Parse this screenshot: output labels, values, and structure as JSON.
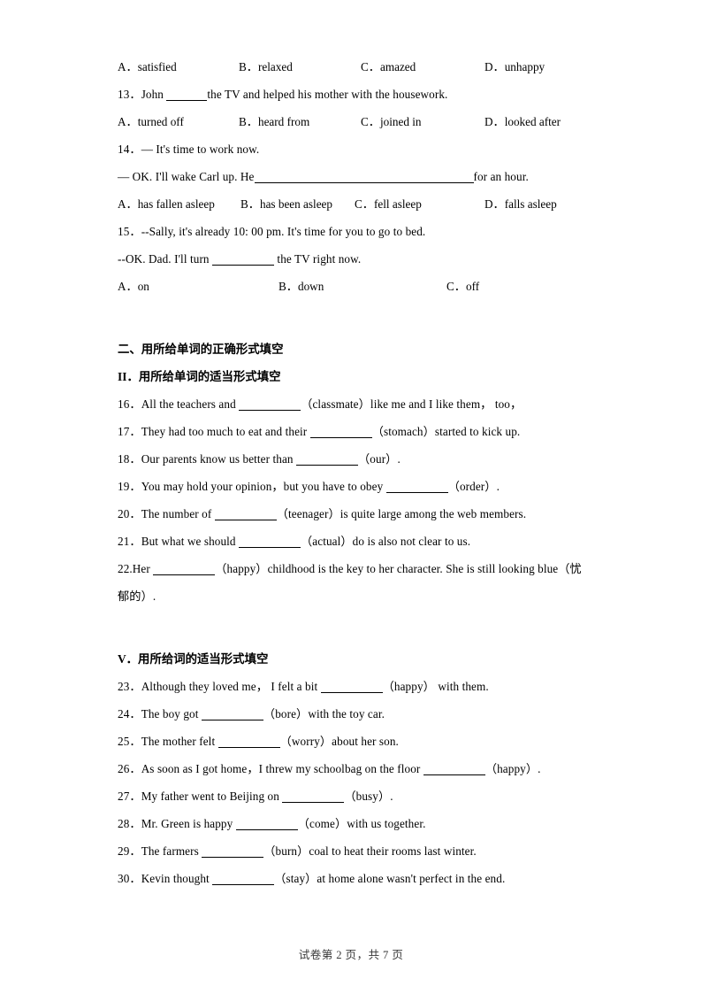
{
  "page": {
    "footer": "试卷第 2 页，共 7 页"
  },
  "multiple_choice": {
    "q12_options": [
      {
        "label": "A．satisfied"
      },
      {
        "label": "B．relaxed"
      },
      {
        "label": "C．amazed"
      },
      {
        "label": "D．unhappy"
      }
    ],
    "q13": {
      "number": "13．",
      "text_before": "John ",
      "text_after": "the TV and helped his mother with the housework.",
      "options": [
        {
          "label": "A．turned off"
        },
        {
          "label": "B．heard from"
        },
        {
          "label": "C．joined in"
        },
        {
          "label": "D．looked after"
        }
      ]
    },
    "q14": {
      "number": "14．",
      "line1": "— It's time to work now.",
      "line2_before": "— OK. I'll wake Carl up. He",
      "line2_after": "for an hour.",
      "options": [
        {
          "label": "A．has fallen asleep"
        },
        {
          "label": "B．has been asleep"
        },
        {
          "label": "C．fell asleep"
        },
        {
          "label": "D．falls asleep"
        }
      ]
    },
    "q15": {
      "number": "15．",
      "line1": "--Sally, it's already 10: 00 pm. It's time for you to go to bed.",
      "line2_before": "--OK. Dad. I'll turn ",
      "line2_after": " the TV right now.",
      "options": [
        {
          "label": "A．on"
        },
        {
          "label": "B．down"
        },
        {
          "label": "C．off"
        }
      ]
    }
  },
  "section_two": {
    "heading": "二、用所给单词的正确形式填空",
    "subheading_roman": "II",
    "subheading_text": "．用所给单词的适当形式填空",
    "items": [
      {
        "number": "16．",
        "before": "All the teachers and ",
        "after": "（classmate）like me and I like them， too，"
      },
      {
        "number": "17．",
        "before": "They had too much to eat and their ",
        "after": "（stomach）started to kick up."
      },
      {
        "number": "18．",
        "before": "Our parents know us better than ",
        "after": "（our）."
      },
      {
        "number": "19．",
        "before": "You may hold your opinion，but you have to obey ",
        "after": "（order）."
      },
      {
        "number": "20．",
        "before": "The number of ",
        "after": "（teenager）is quite large among the web members."
      },
      {
        "number": "21．",
        "before": "But what we should ",
        "after": "（actual）do is also not clear to us."
      }
    ],
    "item22": {
      "number": "22.",
      "before": "Her ",
      "after": "（happy）childhood is the key to her character. She is still looking blue（忧郁的）."
    }
  },
  "section_five": {
    "heading_roman": "V",
    "heading_text": "．用所给词的适当形式填空",
    "items": [
      {
        "number": "23．",
        "before": "Although they loved me， I felt a bit ",
        "after": "（happy） with them."
      },
      {
        "number": "24．",
        "before": "The boy got ",
        "after": "（bore）with the toy car."
      },
      {
        "number": "25．",
        "before": "The mother felt ",
        "after": "（worry）about her son."
      },
      {
        "number": "26．",
        "before": "As soon as I got home，I threw my schoolbag on the floor ",
        "after": "（happy）."
      },
      {
        "number": "27．",
        "before": "My father went to Beijing on ",
        "after": "（busy）."
      },
      {
        "number": "28．",
        "before": "Mr. Green is happy ",
        "after": "（come）with us together."
      },
      {
        "number": "29．",
        "before": "The farmers ",
        "after": "（burn）coal to heat their rooms last winter."
      },
      {
        "number": "30．",
        "before": "Kevin thought ",
        "after": "（stay）at home alone wasn't perfect in the end."
      }
    ]
  }
}
